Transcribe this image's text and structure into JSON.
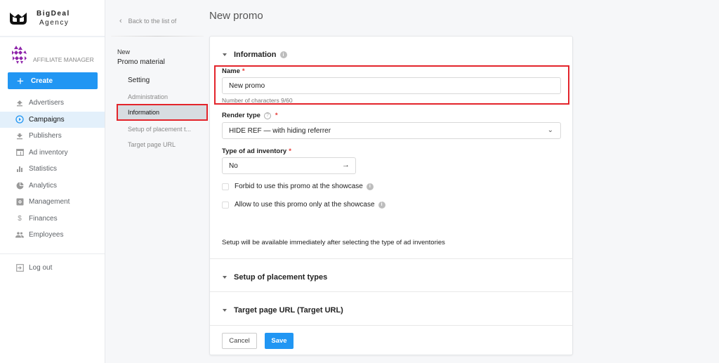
{
  "brand": {
    "line1": "BigDeal",
    "line2": "Agency"
  },
  "user": {
    "role": "AFFILIATE MANAGER"
  },
  "sidebar": {
    "create_label": "Create",
    "items": [
      {
        "label": "Advertisers",
        "icon": "upload-icon"
      },
      {
        "label": "Campaigns",
        "icon": "play-circle-icon",
        "active": true
      },
      {
        "label": "Publishers",
        "icon": "download-icon"
      },
      {
        "label": "Ad inventory",
        "icon": "window-icon"
      },
      {
        "label": "Statistics",
        "icon": "bar-chart-icon"
      },
      {
        "label": "Analytics",
        "icon": "pie-chart-icon"
      },
      {
        "label": "Management",
        "icon": "settings-box-icon"
      },
      {
        "label": "Finances",
        "icon": "dollar-icon"
      },
      {
        "label": "Employees",
        "icon": "people-icon"
      }
    ],
    "logout_label": "Log out"
  },
  "submenu": {
    "back_label": "Back to the list of",
    "new_label": "New",
    "title": "Promo material",
    "setting_label": "Setting",
    "items": [
      {
        "label": "Administration"
      },
      {
        "label": "Information",
        "active": true
      },
      {
        "label": "Setup of placement t..."
      },
      {
        "label": "Target page URL"
      }
    ]
  },
  "page": {
    "title": "New promo"
  },
  "form": {
    "info_section": "Information",
    "name_label": "Name",
    "required_mark": "*",
    "name_value": "New promo",
    "name_hint": "Number of characters 9/60",
    "render_label": "Render type",
    "render_value": "HIDE REF — with hiding referrer",
    "inventory_label": "Type of ad inventory",
    "inventory_value": "No",
    "checkbox1": "Forbid to use this promo at the showcase",
    "checkbox2": "Allow to use this promo only at the showcase",
    "setup_note": "Setup will be available immediately after selecting the type of ad inventories",
    "placement_section": "Setup of placement types",
    "target_section": "Target page URL (Target URL)",
    "cancel_label": "Cancel",
    "save_label": "Save"
  }
}
